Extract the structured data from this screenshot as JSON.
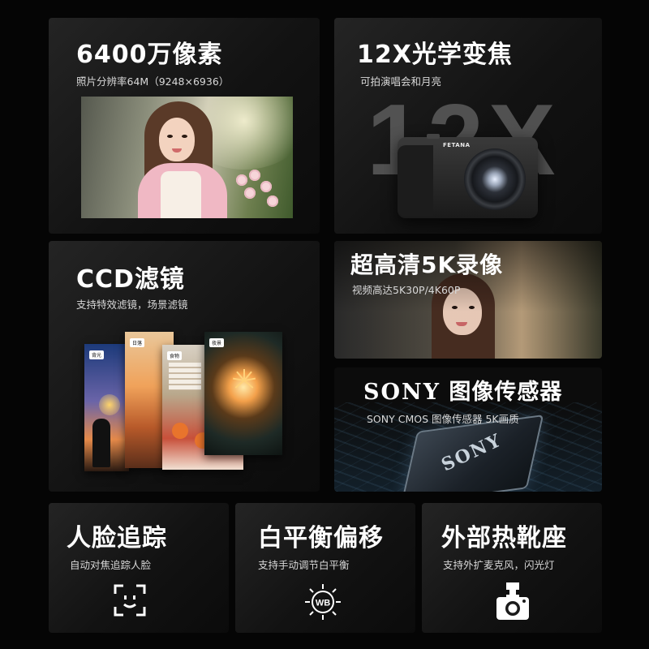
{
  "cards": {
    "pixels": {
      "title": "6400万像素",
      "subtitle": "照片分辨率64M（9248×6936）"
    },
    "zoom": {
      "title": "12X光学变焦",
      "subtitle": "可拍演唱会和月亮",
      "big_text": "12X",
      "camera_brand": "FETANA"
    },
    "ccd": {
      "title": "CCD滤镜",
      "subtitle": "支持特效滤镜，场景滤镜",
      "filters": [
        "背光",
        "日落",
        "食物",
        "夜景"
      ]
    },
    "video": {
      "title": "超高清5K录像",
      "subtitle": "视频高达5K30P/4K60P"
    },
    "sensor": {
      "title_brand": "SONY",
      "title_rest": "图像传感器",
      "subtitle": "SONY CMOS 图像传感器 5K画质",
      "chip_label": "SONY"
    },
    "face": {
      "title": "人脸追踪",
      "subtitle": "自动对焦追踪人脸"
    },
    "wb": {
      "title": "白平衡偏移",
      "subtitle": "支持手动调节白平衡",
      "icon_text": "WB"
    },
    "hotshoe": {
      "title": "外部热靴座",
      "subtitle": "支持外扩麦克风，闪光灯"
    }
  },
  "icons": {
    "face_tracking": "face-frame-icon",
    "white_balance": "wb-sun-icon",
    "hot_shoe": "flash-camera-icon"
  },
  "colors": {
    "background": "#050505",
    "card": "#1a1a1a",
    "text": "#ffffff",
    "subtext": "#d8d8d8"
  }
}
